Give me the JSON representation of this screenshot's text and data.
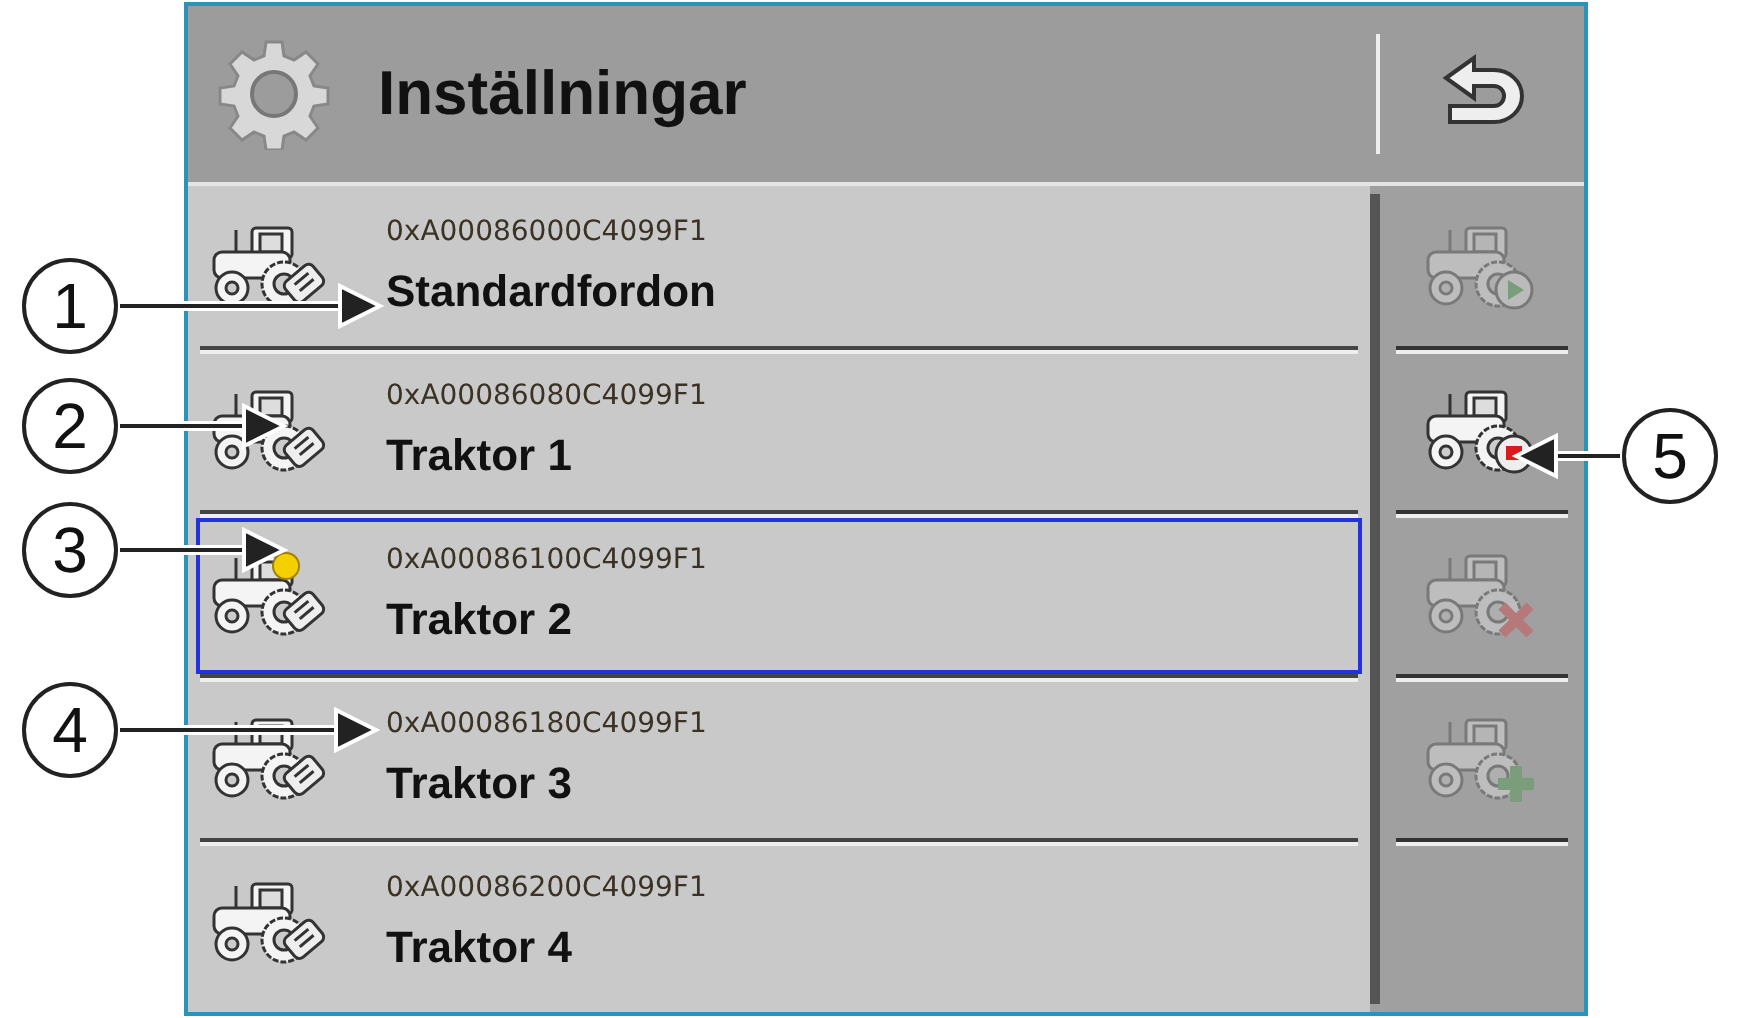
{
  "header": {
    "title": "Inställningar"
  },
  "rows": [
    {
      "id": "0xA00086000C4099F1",
      "name": "Standardfordon",
      "selected": false,
      "active": false
    },
    {
      "id": "0xA00086080C4099F1",
      "name": "Traktor 1",
      "selected": false,
      "active": false
    },
    {
      "id": "0xA00086100C4099F1",
      "name": "Traktor 2",
      "selected": true,
      "active": true
    },
    {
      "id": "0xA00086180C4099F1",
      "name": "Traktor 3",
      "selected": false,
      "active": false
    },
    {
      "id": "0xA00086200C4099F1",
      "name": "Traktor 4",
      "selected": false,
      "active": false
    }
  ],
  "actions": [
    {
      "kind": "start",
      "disabled": true
    },
    {
      "kind": "stop",
      "disabled": false
    },
    {
      "kind": "delete",
      "disabled": true
    },
    {
      "kind": "add",
      "disabled": true
    }
  ],
  "callouts": [
    {
      "label": "1"
    },
    {
      "label": "2"
    },
    {
      "label": "3"
    },
    {
      "label": "4"
    },
    {
      "label": "5"
    }
  ]
}
